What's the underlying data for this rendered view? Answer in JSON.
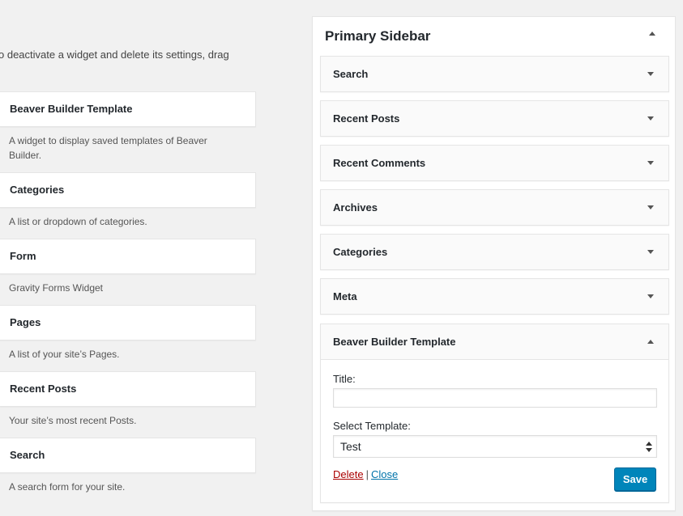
{
  "intro_text": "o deactivate a widget and delete its settings, drag",
  "available_widgets": [
    {
      "title": "Beaver Builder Template",
      "description": "A widget to display saved templates of Beaver Builder."
    },
    {
      "title": "Categories",
      "description": "A list or dropdown of categories."
    },
    {
      "title": "Form",
      "description": "Gravity Forms Widget"
    },
    {
      "title": "Pages",
      "description": "A list of your site’s Pages."
    },
    {
      "title": "Recent Posts",
      "description": "Your site’s most recent Posts."
    },
    {
      "title": "Search",
      "description": "A search form for your site."
    }
  ],
  "sidebar": {
    "title": "Primary Sidebar",
    "widgets": [
      {
        "title": "Search"
      },
      {
        "title": "Recent Posts"
      },
      {
        "title": "Recent Comments"
      },
      {
        "title": "Archives"
      },
      {
        "title": "Categories"
      },
      {
        "title": "Meta"
      }
    ],
    "open_widget": {
      "title": "Beaver Builder Template",
      "title_label": "Title:",
      "title_value": "",
      "template_label": "Select Template:",
      "template_value": "Test",
      "delete_label": "Delete",
      "separator": "|",
      "close_label": "Close",
      "save_label": "Save"
    }
  },
  "colors": {
    "accent": "#0085ba",
    "delete": "#aa0000",
    "link": "#0073aa",
    "background": "#f1f1f1"
  }
}
